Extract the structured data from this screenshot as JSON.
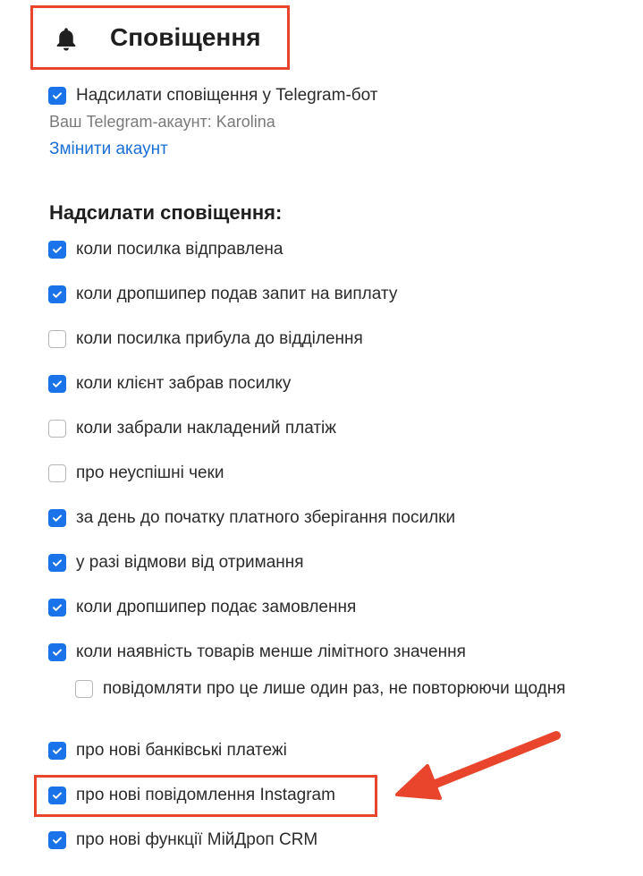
{
  "header": {
    "title": "Сповіщення",
    "icon": "bell-icon"
  },
  "telegram": {
    "checkbox_label": "Надсилати сповіщення у Telegram-бот",
    "checked": true,
    "account_text": "Ваш Telegram-акаунт: Karolina",
    "change_link": "Змінити акаунт"
  },
  "notifications": {
    "title": "Надсилати сповіщення:",
    "items": [
      {
        "label": "коли посилка відправлена",
        "checked": true
      },
      {
        "label": "коли дропшипер подав запит на виплату",
        "checked": true
      },
      {
        "label": "коли посилка прибула до відділення",
        "checked": false
      },
      {
        "label": "коли клієнт забрав посилку",
        "checked": true
      },
      {
        "label": "коли забрали накладений платіж",
        "checked": false
      },
      {
        "label": "про неуспішні чеки",
        "checked": false
      },
      {
        "label": "за день до початку платного зберігання посилки",
        "checked": true
      },
      {
        "label": "у разі відмови від отримання",
        "checked": true
      },
      {
        "label": "коли дропшипер подає замовлення",
        "checked": true
      },
      {
        "label": "коли наявність товарів менше лімітного значення",
        "checked": true
      },
      {
        "label": "повідомляти про це лише один раз, не повторюючи щодня",
        "checked": false
      },
      {
        "label": "про нові банківські платежі",
        "checked": true
      },
      {
        "label": "про нові повідомлення Instagram",
        "checked": true
      },
      {
        "label": "про нові функції МійДроп CRM",
        "checked": true
      }
    ]
  },
  "colors": {
    "accent": "#1a73e8",
    "annotation": "#e8452c",
    "link": "#1a6fd6"
  }
}
